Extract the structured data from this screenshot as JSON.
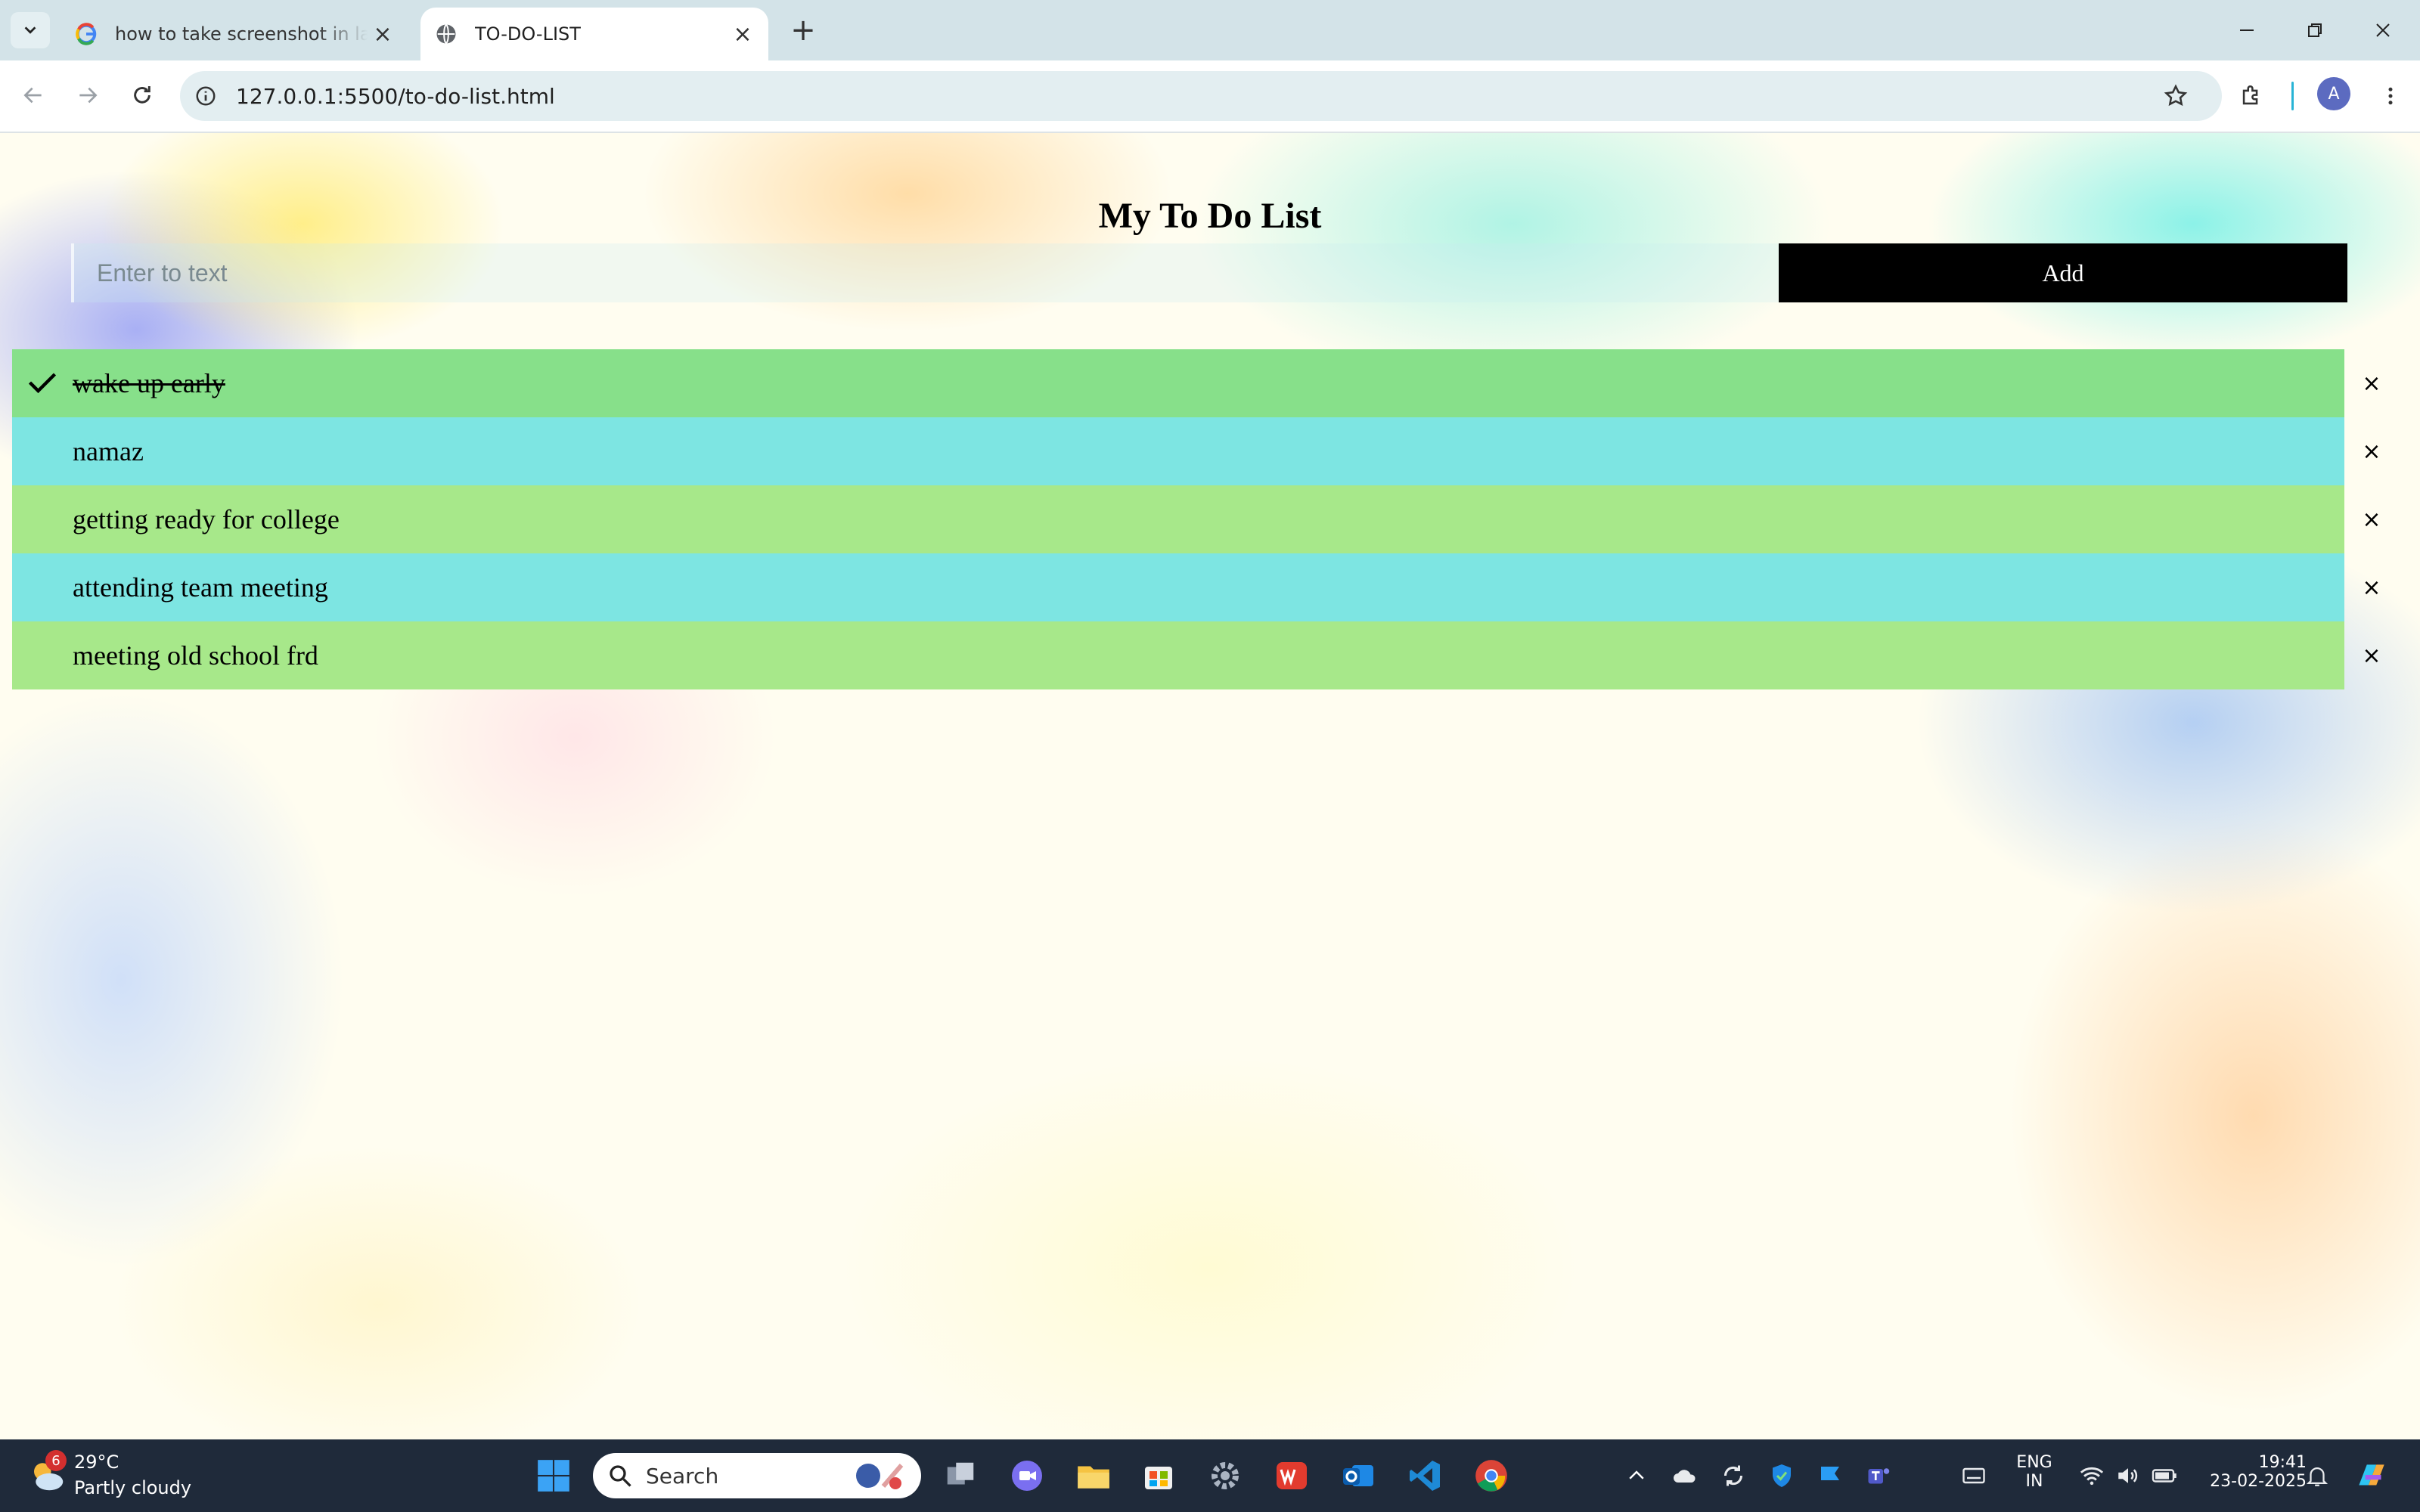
{
  "browser": {
    "tabs": [
      {
        "title": "how to take screenshot in laptop",
        "active": false
      },
      {
        "title": "TO-DO-LIST",
        "active": true
      }
    ],
    "url": "127.0.0.1:5500/to-do-list.html",
    "profile_initial": "A"
  },
  "app": {
    "title": "My To Do List",
    "input_placeholder": "Enter to text",
    "add_label": "Add",
    "remove_symbol": "×",
    "items": [
      {
        "text": "wake up early",
        "done": true,
        "color": "#87e08a"
      },
      {
        "text": "namaz",
        "done": false,
        "color": "#7de5e2"
      },
      {
        "text": "getting ready for college",
        "done": false,
        "color": "#a7e88a"
      },
      {
        "text": "attending team meeting",
        "done": false,
        "color": "#7de5e2"
      },
      {
        "text": "meeting old school frd",
        "done": false,
        "color": "#a7e88a"
      }
    ]
  },
  "taskbar": {
    "weather_badge": "6",
    "temperature": "29°C",
    "condition": "Partly cloudy",
    "search_label": "Search",
    "lang_line1": "ENG",
    "lang_line2": "IN",
    "time": "19:41",
    "date": "23-02-2025"
  }
}
